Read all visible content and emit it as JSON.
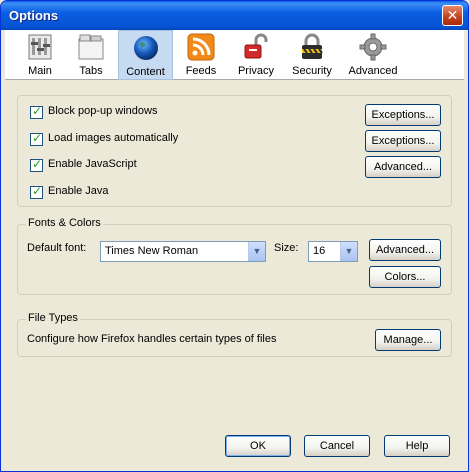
{
  "window": {
    "title": "Options",
    "close_glyph": "✕"
  },
  "toolbar": {
    "tabs": [
      {
        "label": "Main",
        "icon": "main-icon"
      },
      {
        "label": "Tabs",
        "icon": "tabs-icon"
      },
      {
        "label": "Content",
        "icon": "content-globe-icon",
        "selected": true
      },
      {
        "label": "Feeds",
        "icon": "feeds-icon"
      },
      {
        "label": "Privacy",
        "icon": "privacy-lock-icon"
      },
      {
        "label": "Security",
        "icon": "security-padlock-icon"
      },
      {
        "label": "Advanced",
        "icon": "advanced-gear-icon"
      }
    ]
  },
  "content": {
    "checkboxes": [
      {
        "label": "Block pop-up windows",
        "checked": true
      },
      {
        "label": "Load images automatically",
        "checked": true
      },
      {
        "label": "Enable JavaScript",
        "checked": true
      },
      {
        "label": "Enable Java",
        "checked": true
      }
    ],
    "buttons": {
      "exceptions1": "Exceptions...",
      "exceptions2": "Exceptions...",
      "advanced_js": "Advanced..."
    }
  },
  "fonts": {
    "group_label": "Fonts & Colors",
    "default_font_label": "Default font:",
    "default_font_value": "Times New Roman",
    "size_label": "Size:",
    "size_value": "16",
    "advanced_button": "Advanced...",
    "colors_button": "Colors..."
  },
  "file_types": {
    "group_label": "File Types",
    "description": "Configure how Firefox handles certain types of files",
    "manage_button": "Manage..."
  },
  "footer": {
    "ok": "OK",
    "cancel": "Cancel",
    "help": "Help"
  },
  "colors": {
    "title_blue": "#0654d4",
    "selected_tab": "#c6daf2",
    "check_green": "#21a121"
  }
}
